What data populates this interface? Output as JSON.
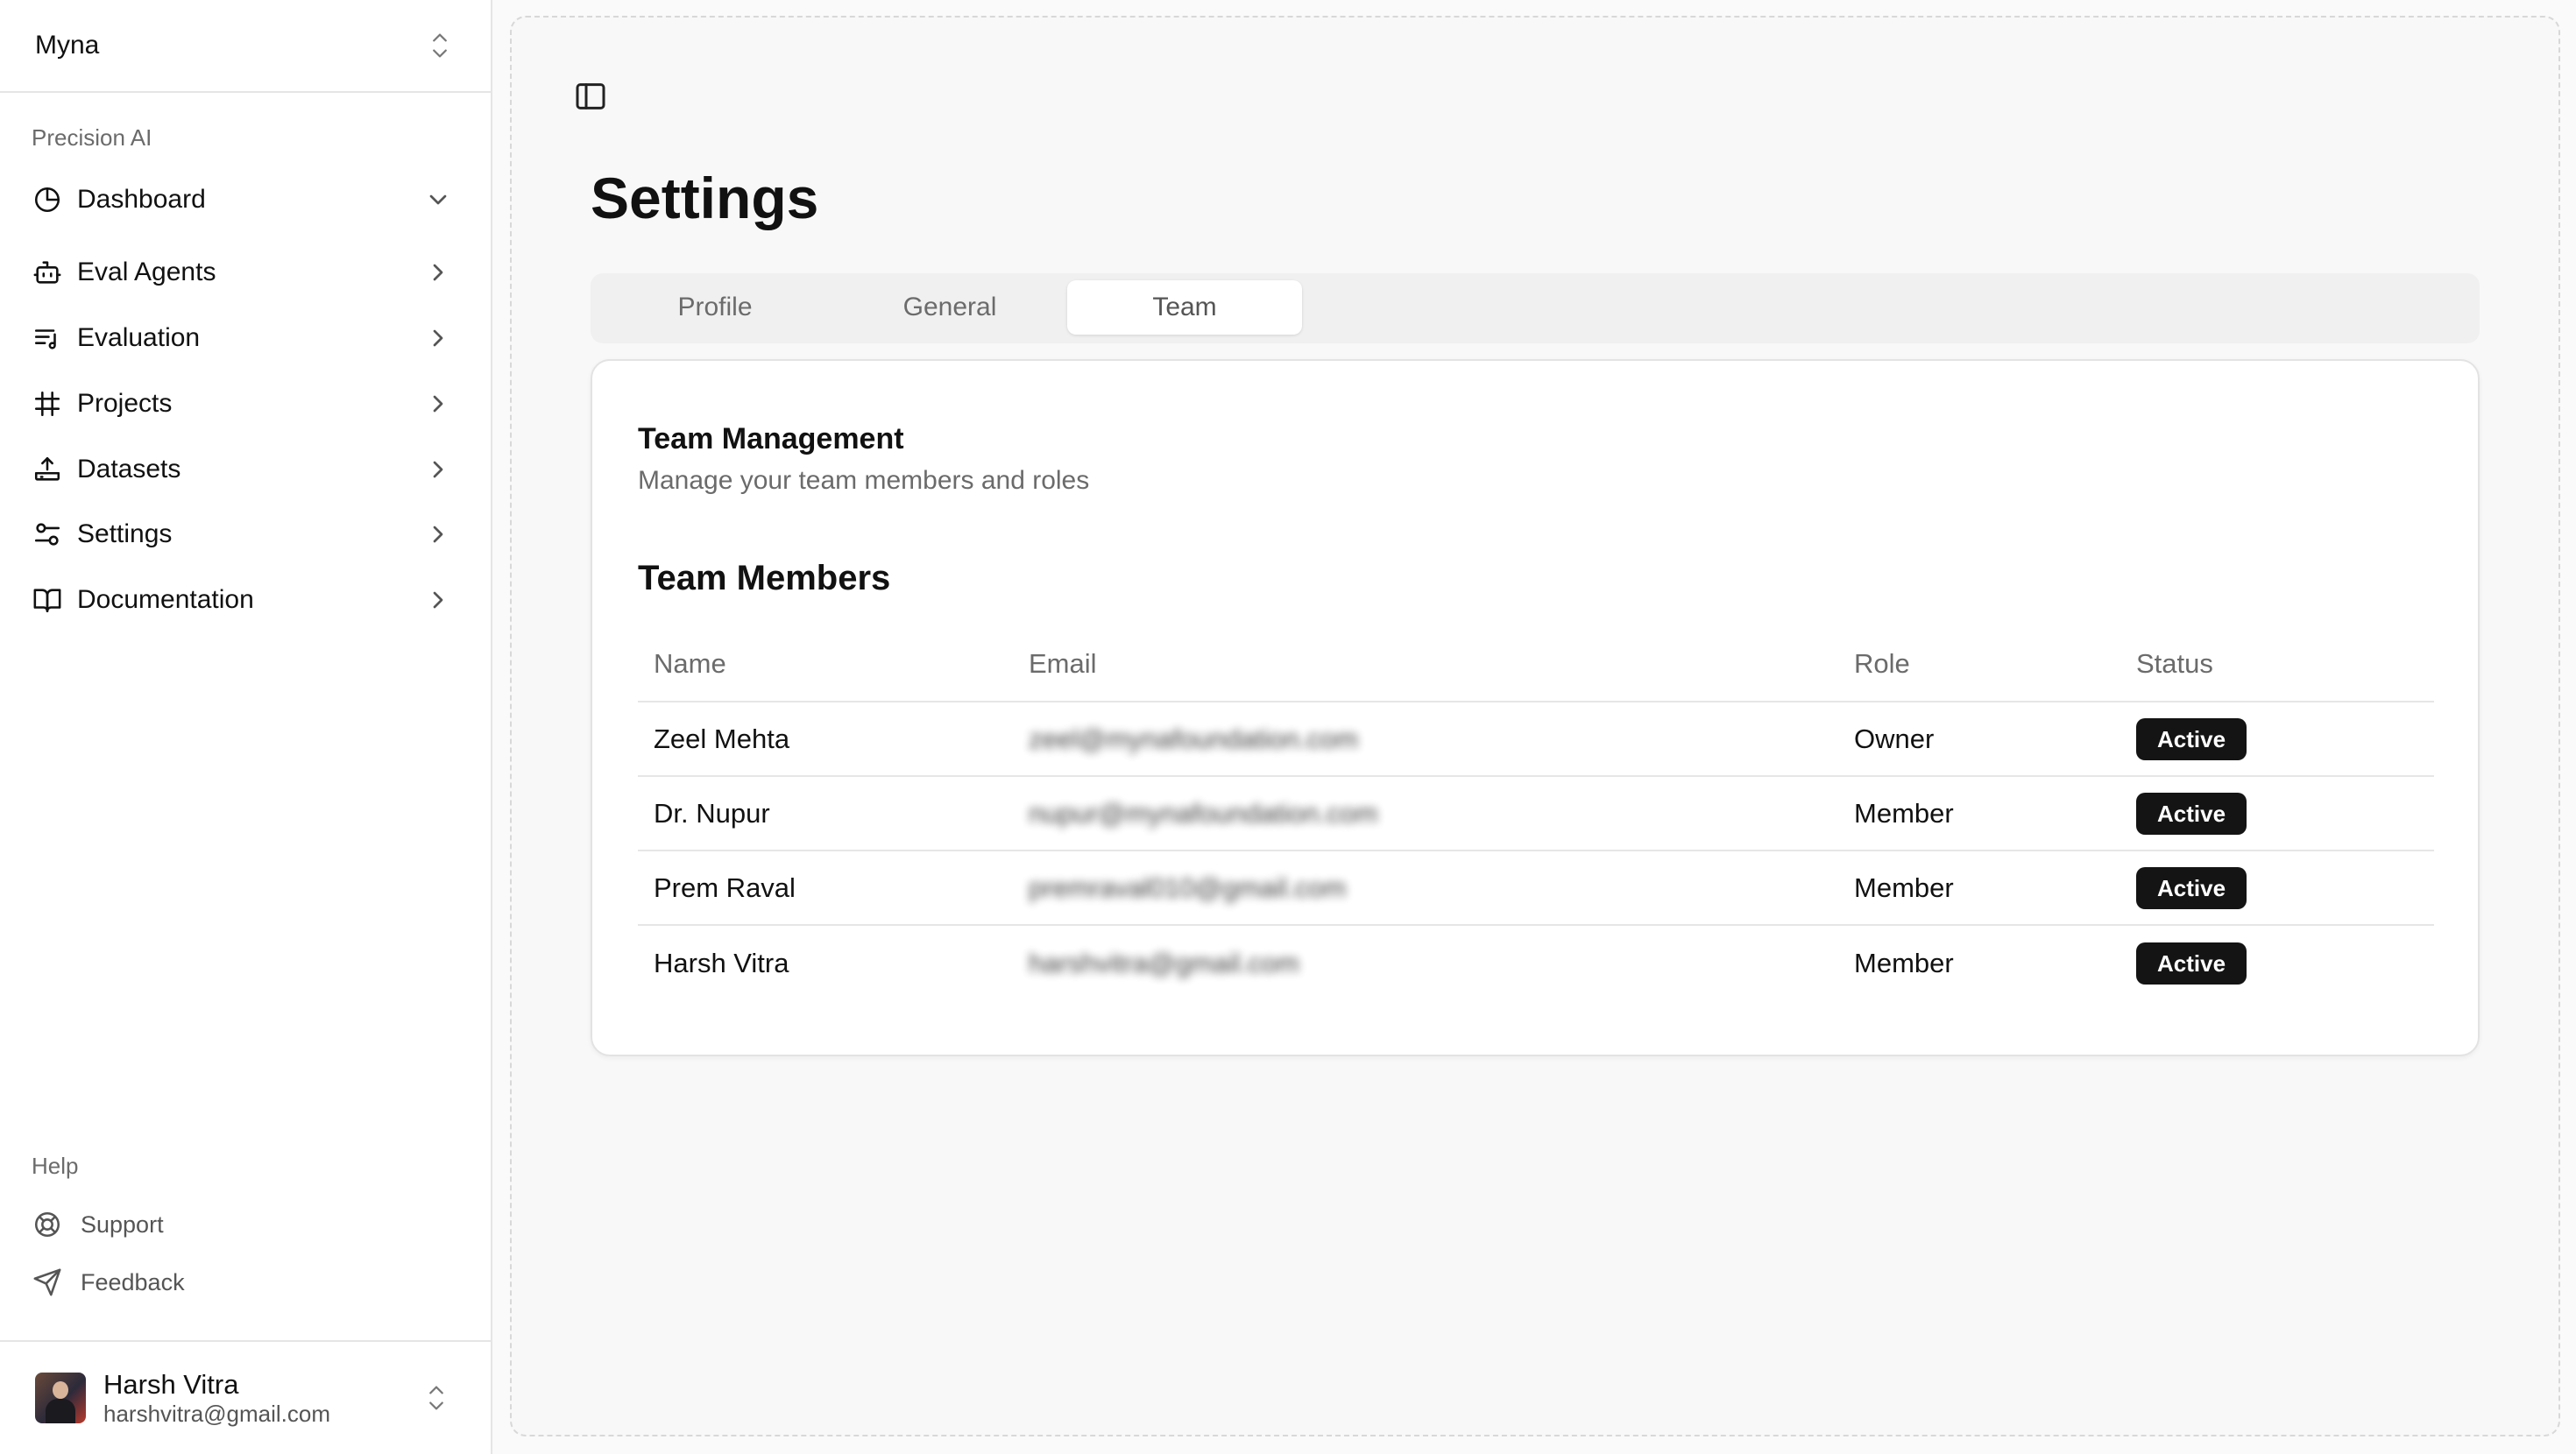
{
  "workspace": {
    "name": "Myna"
  },
  "sidebar": {
    "group_label": "Precision AI",
    "items": [
      {
        "label": "Dashboard",
        "icon": "pie-chart-icon",
        "expanded": true
      },
      {
        "label": "Eval Agents",
        "icon": "bot-icon"
      },
      {
        "label": "Evaluation",
        "icon": "list-music-icon"
      },
      {
        "label": "Projects",
        "icon": "hash-icon"
      },
      {
        "label": "Datasets",
        "icon": "upload-tray-icon"
      },
      {
        "label": "Settings",
        "icon": "settings-toggles-icon"
      },
      {
        "label": "Documentation",
        "icon": "book-open-icon"
      }
    ],
    "help_label": "Help",
    "help_items": [
      {
        "label": "Support",
        "icon": "life-buoy-icon"
      },
      {
        "label": "Feedback",
        "icon": "send-icon"
      }
    ]
  },
  "user": {
    "name": "Harsh Vitra",
    "email": "harshvitra@gmail.com"
  },
  "page": {
    "title": "Settings",
    "tabs": [
      {
        "label": "Profile"
      },
      {
        "label": "General"
      },
      {
        "label": "Team",
        "active": true
      }
    ]
  },
  "card": {
    "title": "Team Management",
    "description": "Manage your team members and roles",
    "section_title": "Team Members",
    "columns": [
      "Name",
      "Email",
      "Role",
      "Status"
    ],
    "rows": [
      {
        "name": "Zeel Mehta",
        "email": "zeel@mynafoundation.com",
        "role": "Owner",
        "status": "Active"
      },
      {
        "name": "Dr. Nupur",
        "email": "nupur@mynafoundation.com",
        "role": "Member",
        "status": "Active"
      },
      {
        "name": "Prem Raval",
        "email": "premraval010@gmail.com",
        "role": "Member",
        "status": "Active"
      },
      {
        "name": "Harsh Vitra",
        "email": "harshvitra@gmail.com",
        "role": "Member",
        "status": "Active"
      }
    ]
  },
  "colors": {
    "badge_bg": "#141414",
    "border": "#e5e5e5",
    "muted_text": "#6b6b6b"
  }
}
